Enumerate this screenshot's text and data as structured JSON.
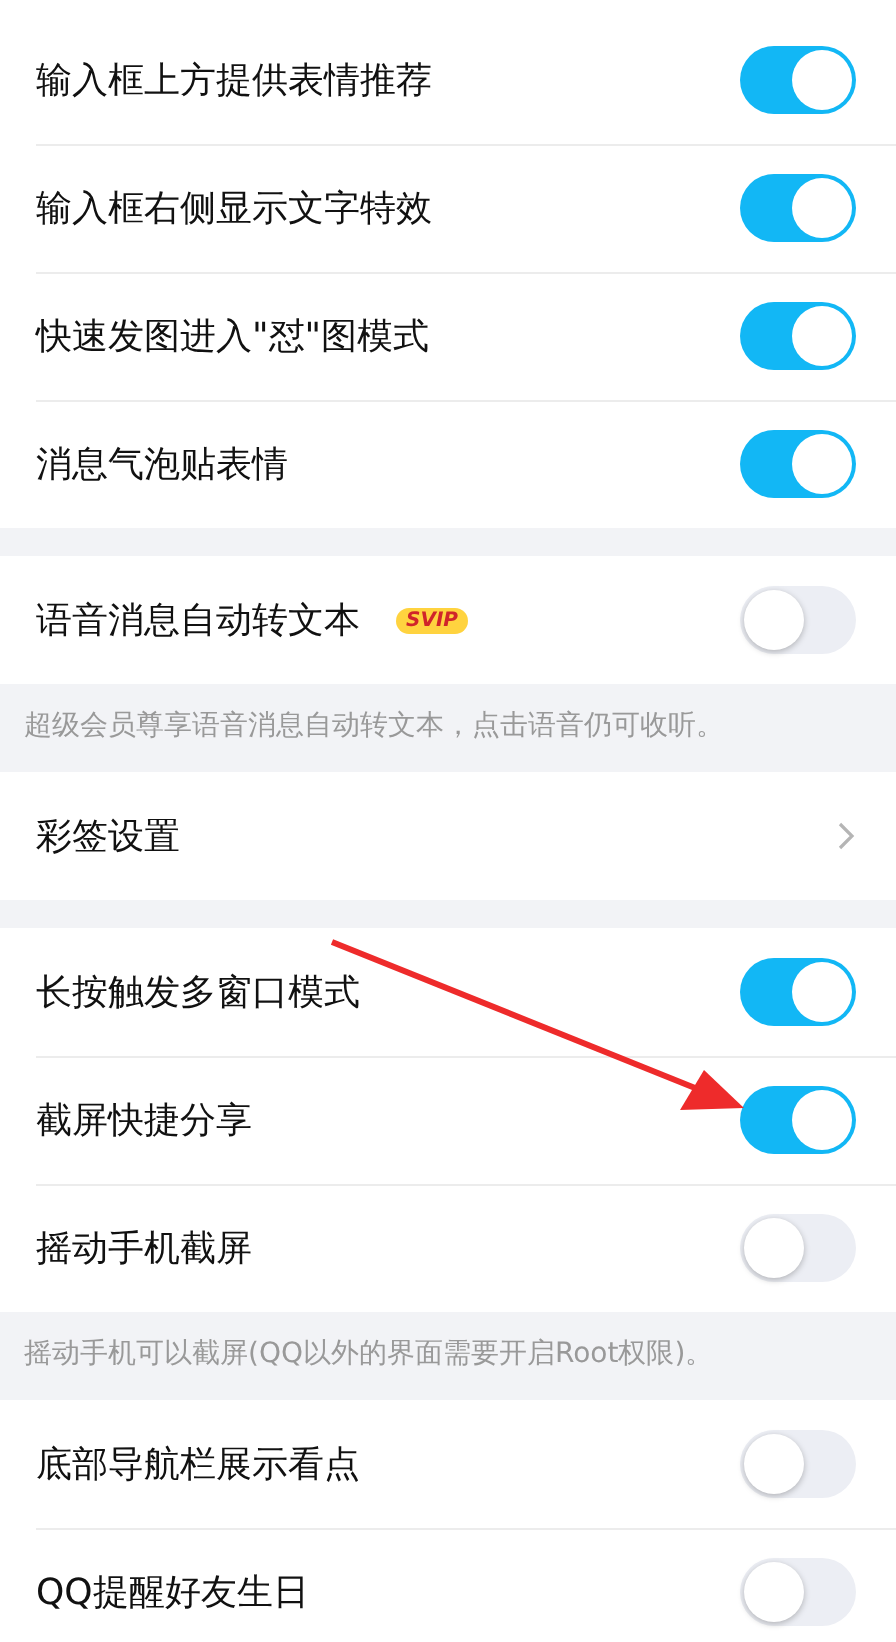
{
  "sections": [
    {
      "items": [
        {
          "kind": "toggle",
          "label": "输入框上方提供表情推荐",
          "on": true
        },
        {
          "kind": "toggle",
          "label": "输入框右侧显示文字特效",
          "on": true
        },
        {
          "kind": "toggle",
          "label": "快速发图进入\"怼\"图模式",
          "on": true
        },
        {
          "kind": "toggle",
          "label": "消息气泡贴表情",
          "on": true
        }
      ]
    },
    {
      "items": [
        {
          "kind": "toggle",
          "label": "语音消息自动转文本",
          "badge": "SVIP",
          "on": false
        }
      ],
      "note": "超级会员尊享语音消息自动转文本，点击语音仍可收听。"
    },
    {
      "items": [
        {
          "kind": "link",
          "label": "彩签设置"
        }
      ]
    },
    {
      "items": [
        {
          "kind": "toggle",
          "label": "长按触发多窗口模式",
          "on": true
        },
        {
          "kind": "toggle",
          "label": "截屏快捷分享",
          "on": true
        },
        {
          "kind": "toggle",
          "label": "摇动手机截屏",
          "on": false
        }
      ],
      "note": "摇动手机可以截屏(QQ以外的界面需要开启Root权限)。"
    },
    {
      "items": [
        {
          "kind": "toggle",
          "label": "底部导航栏展示看点",
          "on": false
        },
        {
          "kind": "toggle",
          "label": "QQ提醒好友生日",
          "on": false
        }
      ]
    }
  ]
}
